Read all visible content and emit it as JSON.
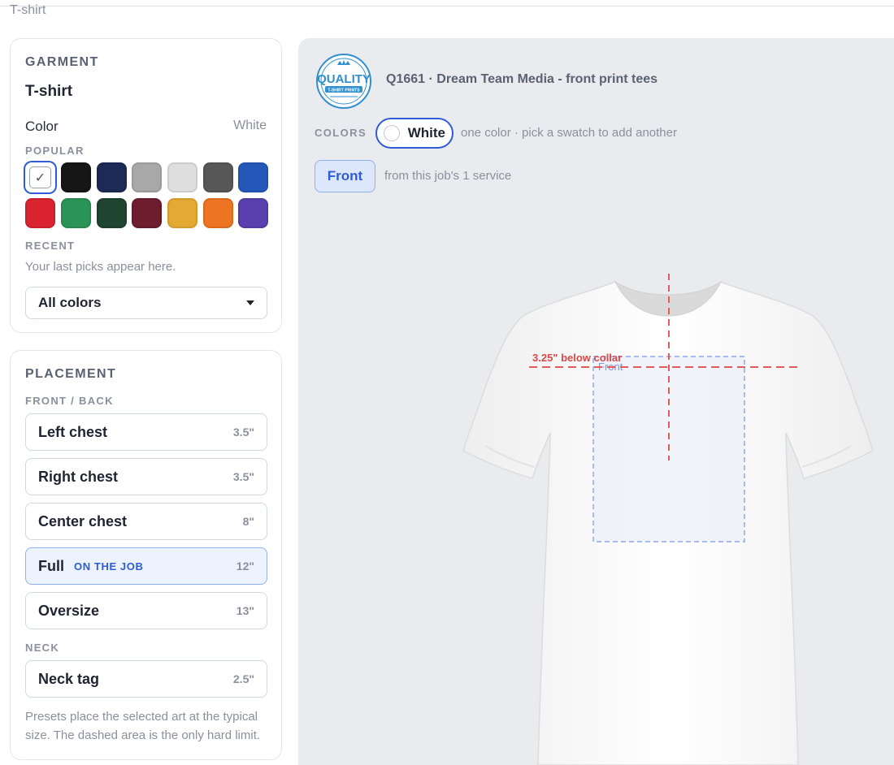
{
  "breadcrumb": "T-shirt",
  "garment": {
    "title": "GARMENT",
    "name": "T-shirt",
    "color_label": "Color",
    "color_value": "White",
    "popular_label": "POPULAR",
    "swatches": [
      {
        "name": "White",
        "color": "#ffffff",
        "selected": true
      },
      {
        "name": "Black",
        "color": "#161616"
      },
      {
        "name": "Navy",
        "color": "#1d2a55"
      },
      {
        "name": "Gray",
        "color": "#a8a8a8"
      },
      {
        "name": "Light Gray",
        "color": "#dedede"
      },
      {
        "name": "Charcoal",
        "color": "#575757"
      },
      {
        "name": "Royal Blue",
        "color": "#2357b8"
      },
      {
        "name": "Red",
        "color": "#d9232f"
      },
      {
        "name": "Green",
        "color": "#2a9356"
      },
      {
        "name": "Forest Green",
        "color": "#1f4430"
      },
      {
        "name": "Maroon",
        "color": "#6e1d2f"
      },
      {
        "name": "Gold",
        "color": "#e3a932"
      },
      {
        "name": "Orange",
        "color": "#ec7423"
      },
      {
        "name": "Purple",
        "color": "#5a3fae"
      }
    ],
    "recent_label": "RECENT",
    "recent_hint": "Your last picks appear here.",
    "all_colors": "All colors"
  },
  "placement": {
    "title": "PLACEMENT",
    "front_back_label": "FRONT / BACK",
    "options": [
      {
        "name": "Left chest",
        "size": "3.5\""
      },
      {
        "name": "Right chest",
        "size": "3.5\""
      },
      {
        "name": "Center chest",
        "size": "8\""
      },
      {
        "name": "Full",
        "tag": "ON THE JOB",
        "size": "12\"",
        "active": true
      },
      {
        "name": "Oversize",
        "size": "13\""
      }
    ],
    "neck_label": "NECK",
    "neck_option": {
      "name": "Neck tag",
      "size": "2.5\""
    },
    "footer_hint": "Presets place the selected art at the typical size. The dashed area is the only hard limit."
  },
  "preview": {
    "logo_text": "QUALITY",
    "logo_sub": "T-SHIRT PRINTS",
    "job_title": "Q1661 · Dream Team Media - front print tees",
    "colors_label": "COLORS",
    "selected_color": "White",
    "colors_hint": "one color · pick a swatch to add another",
    "side_button": "Front",
    "side_hint": "from this job's 1 service",
    "guide_label": "3.25\" below collar",
    "print_area_label": "Front"
  }
}
